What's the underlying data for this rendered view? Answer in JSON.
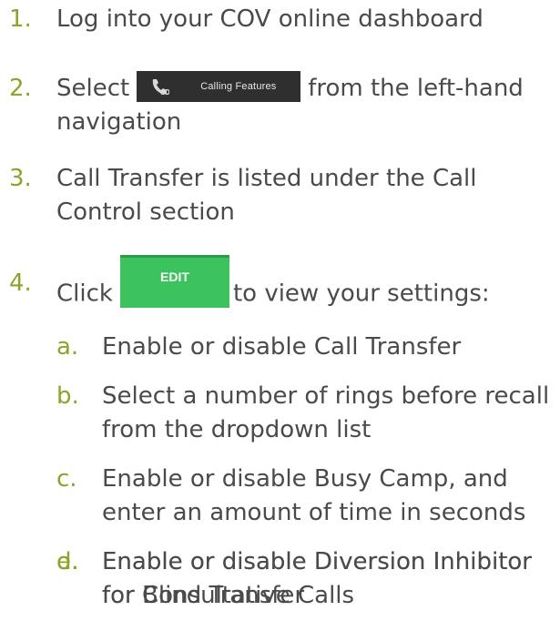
{
  "steps": [
    {
      "num": "1.",
      "text": "Log into your COV online dashboard"
    },
    {
      "num": "2.",
      "before": "Select",
      "after_line1": "from the left-hand",
      "line2": "navigation",
      "button_label": "Calling Features",
      "button_icon": "phone-handset-icon"
    },
    {
      "num": "3.",
      "line1": "Call Transfer is listed under the Call",
      "line2": "Control section"
    },
    {
      "num": "4.",
      "before": "Click",
      "after": "to view your settings:",
      "button_label": "EDIT"
    }
  ],
  "substeps": [
    {
      "num": "a.",
      "line1": "Enable or disable Call Transfer"
    },
    {
      "num": "b.",
      "line1": "Select a number of rings before recall",
      "line2": "from the dropdown list"
    },
    {
      "num": "c.",
      "line1": "Enable or disable Busy Camp, and",
      "line2": "enter an amount of time in seconds"
    },
    {
      "num": "d.",
      "line1": "Enable or disable Diversion Inhibitor",
      "line2": "for Blind Transfer"
    },
    {
      "num": "e.",
      "line1": "Enable or disable Diversion Inhibitor",
      "line2": "for Consultative Calls"
    }
  ],
  "colors": {
    "number": "#8aa52a",
    "text": "#4a4a4a",
    "calling_bg": "#2f2f2f",
    "edit_bg": "#3cc35e"
  }
}
